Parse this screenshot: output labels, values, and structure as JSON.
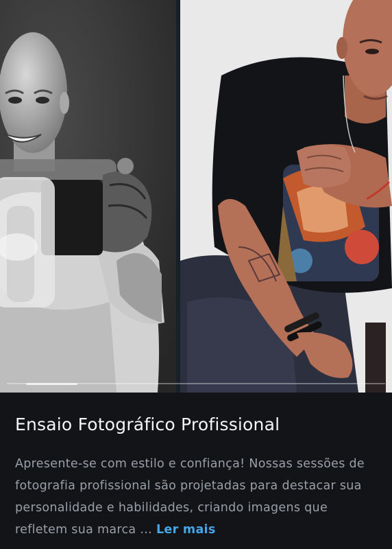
{
  "gallery": {
    "slides": [
      {
        "label": "Black and white portrait of smiling bald man holding a camera toward the viewer"
      },
      {
        "label": "Color portrait of bald man in black graphic t-shirt seated against white backdrop"
      }
    ],
    "pager": {
      "current": 1,
      "total": 7
    }
  },
  "card": {
    "title": "Ensaio Fotográfico Profissional",
    "description": "Apresente-se com estilo e confiança! Nossas sessões de fotografia profissional são projetadas para destacar sua personalidade e habilidades, criando imagens que refletem sua marca …",
    "read_more": "Ler mais"
  },
  "colors": {
    "background": "#121418",
    "title": "#f4f5f7",
    "text": "#9aa0a8",
    "link": "#46a6e8"
  }
}
